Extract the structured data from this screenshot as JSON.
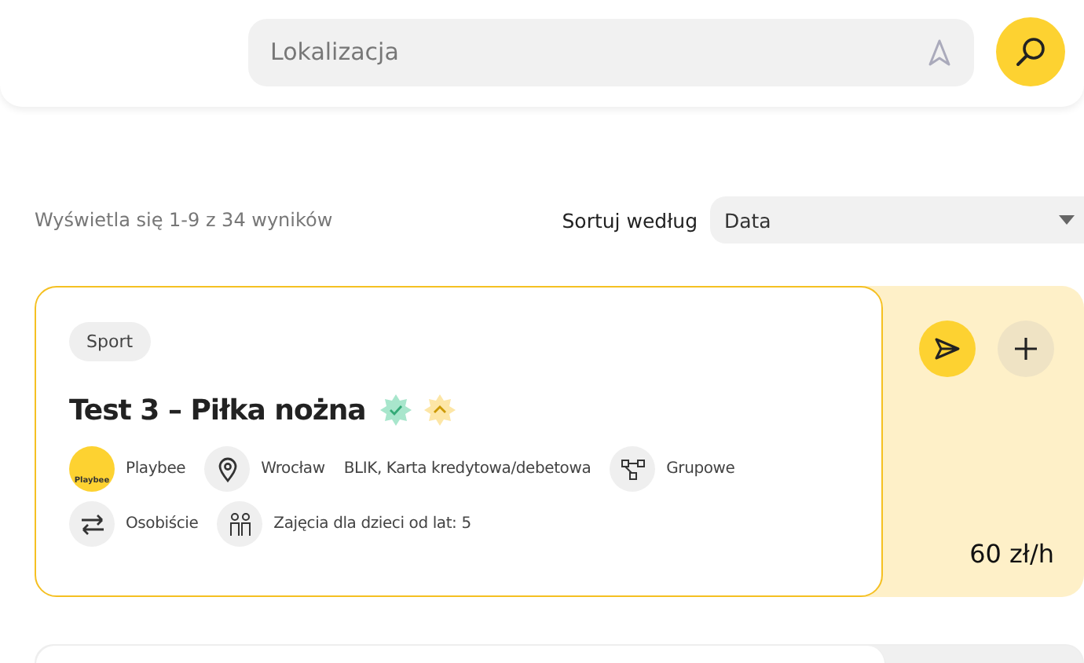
{
  "search": {
    "placeholder": "Lokalizacja"
  },
  "results": {
    "summary": "Wyświetla się 1-9 z 34 wyników",
    "sort_label": "Sortuj według",
    "sort_value": "Data"
  },
  "listings": [
    {
      "category": "Sport",
      "title": "Test 3 – Piłka nożna",
      "verified": true,
      "promoted": true,
      "organizer": "Playbee",
      "logo_text": "Playbee",
      "details": [
        {
          "kind": "location",
          "text": "Wrocław"
        },
        {
          "kind": "payment",
          "text": "BLIK, Karta kredytowa/debetowa"
        },
        {
          "kind": "group",
          "text": "Grupowe"
        },
        {
          "kind": "mode",
          "text": "Osobiście"
        },
        {
          "kind": "age",
          "text": "Zajęcia dla dzieci od lat: 5"
        }
      ],
      "price": "60 zł/h"
    }
  ]
}
